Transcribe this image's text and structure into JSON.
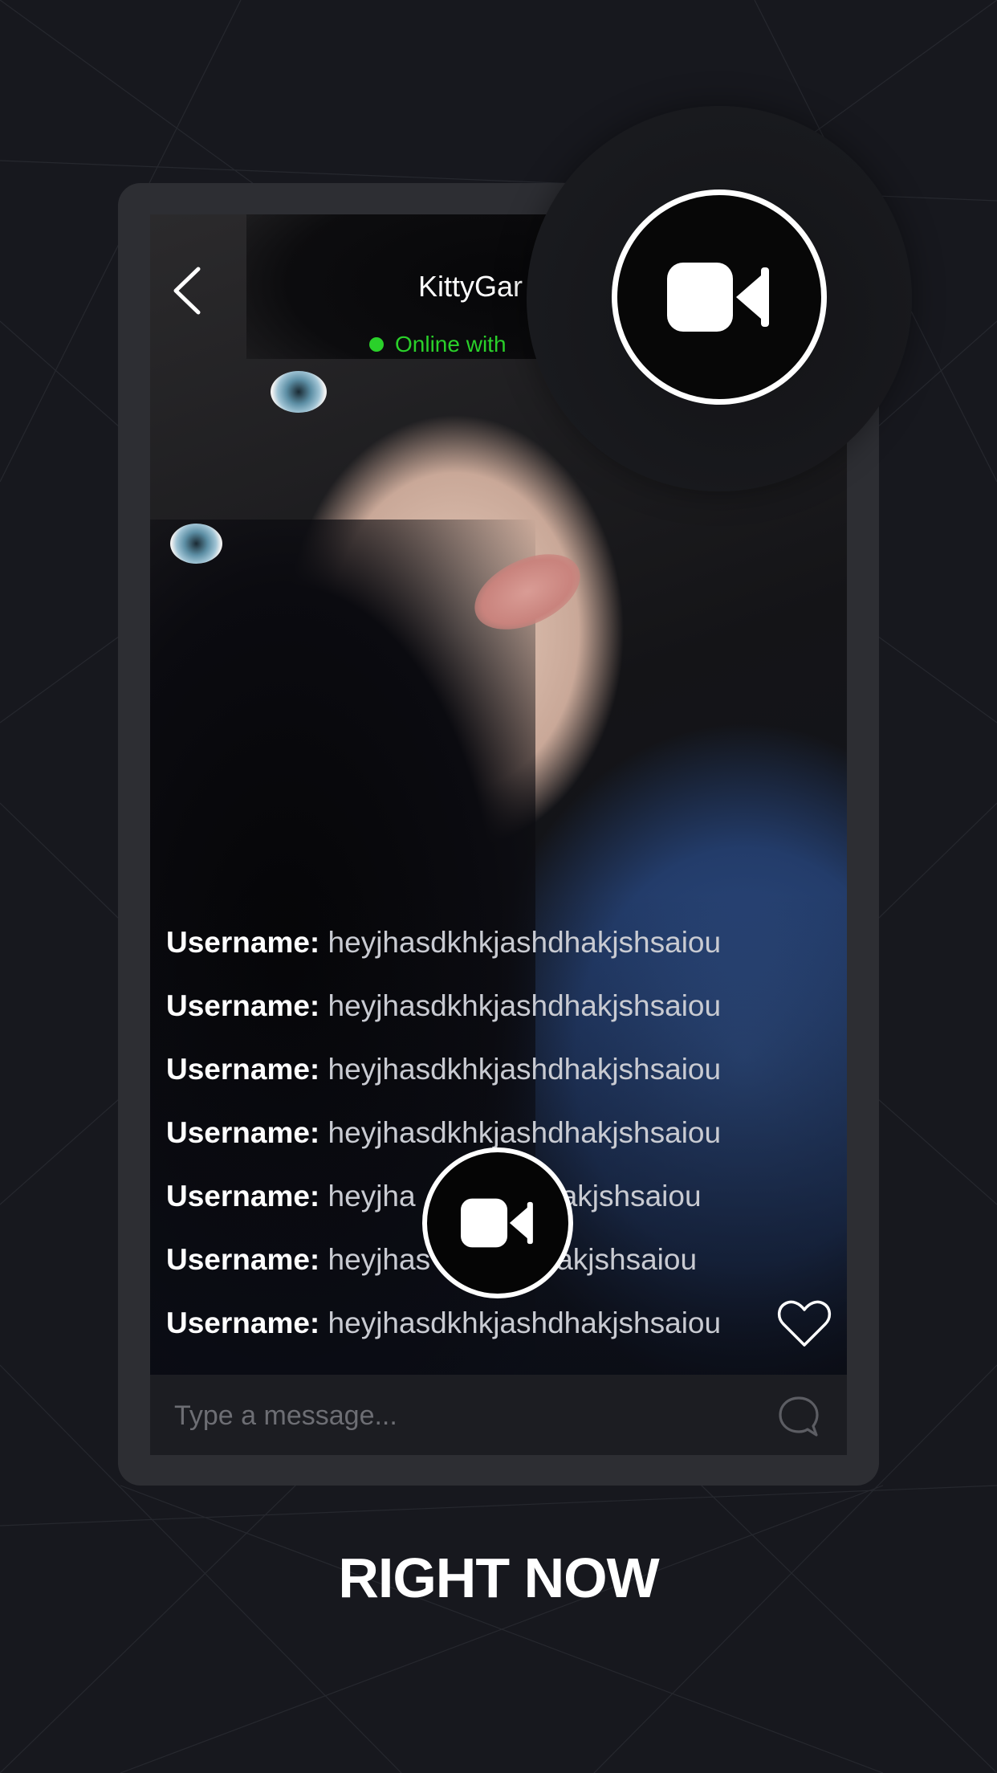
{
  "header": {
    "title": "KittyGar",
    "status": "Online with",
    "status_color": "#2ad12a"
  },
  "messages": [
    {
      "user": "Username:",
      "text": "heyjhasdkhkjashdhakjshsaiou"
    },
    {
      "user": "Username:",
      "text": "heyjhasdkhkjashdhakjshsaiou"
    },
    {
      "user": "Username:",
      "text": "heyjhasdkhkjashdhakjshsaiou"
    },
    {
      "user": "Username:",
      "text": "heyjhasdkhkjashdhakjshsaiou"
    },
    {
      "user": "Username:",
      "text": "heyjha",
      "text_tail": "dhakjshsaiou"
    },
    {
      "user": "Username:",
      "text": "heyjhas",
      "text_tail": "dhakjshsaiou"
    },
    {
      "user": "Username:",
      "text": "heyjhasdkhkjashdhakjshsaiou"
    }
  ],
  "composer": {
    "placeholder": "Type a message..."
  },
  "icons": {
    "back": "chevron-left-icon",
    "heart": "heart-icon",
    "send": "chat-bubble-icon",
    "video": "video-camera-icon"
  },
  "footer": {
    "title": "RIGHT NOW"
  }
}
